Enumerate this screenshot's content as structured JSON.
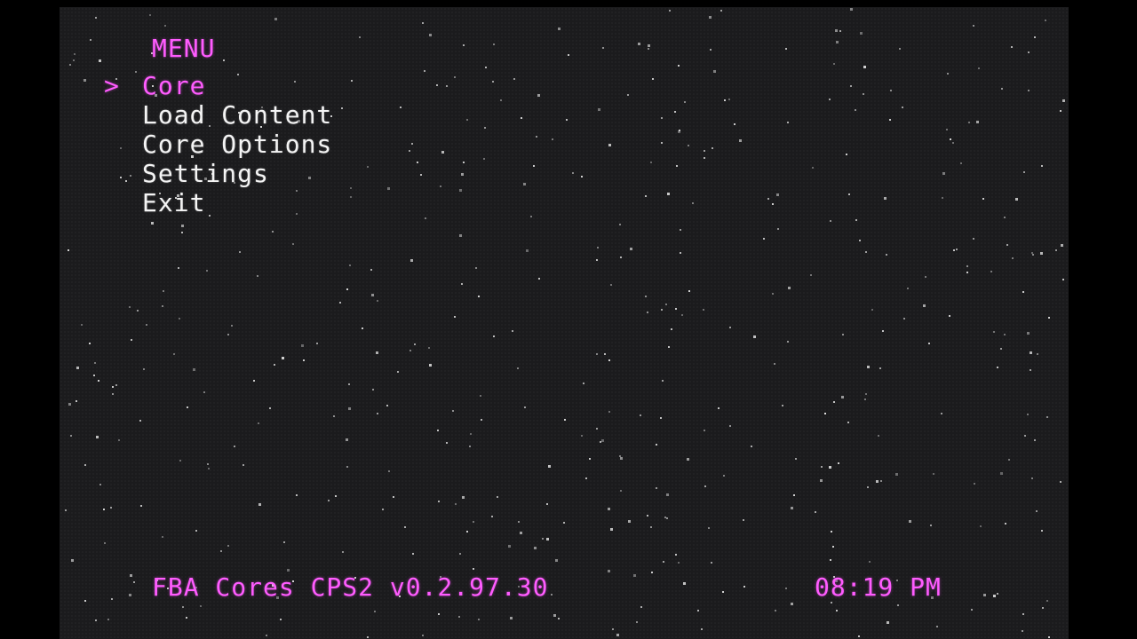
{
  "menu": {
    "title": "MENU",
    "cursor": ">",
    "selected_index": 0,
    "items": [
      {
        "label": "Core"
      },
      {
        "label": "Load Content"
      },
      {
        "label": "Core Options"
      },
      {
        "label": "Settings"
      },
      {
        "label": "Exit"
      }
    ]
  },
  "footer": {
    "version": "FBA Cores CPS2 v0.2.97.30",
    "clock": "08:19 PM"
  },
  "colors": {
    "accent": "#ff5cff",
    "text": "#f4f4f4",
    "background": "#1b1b1d"
  }
}
